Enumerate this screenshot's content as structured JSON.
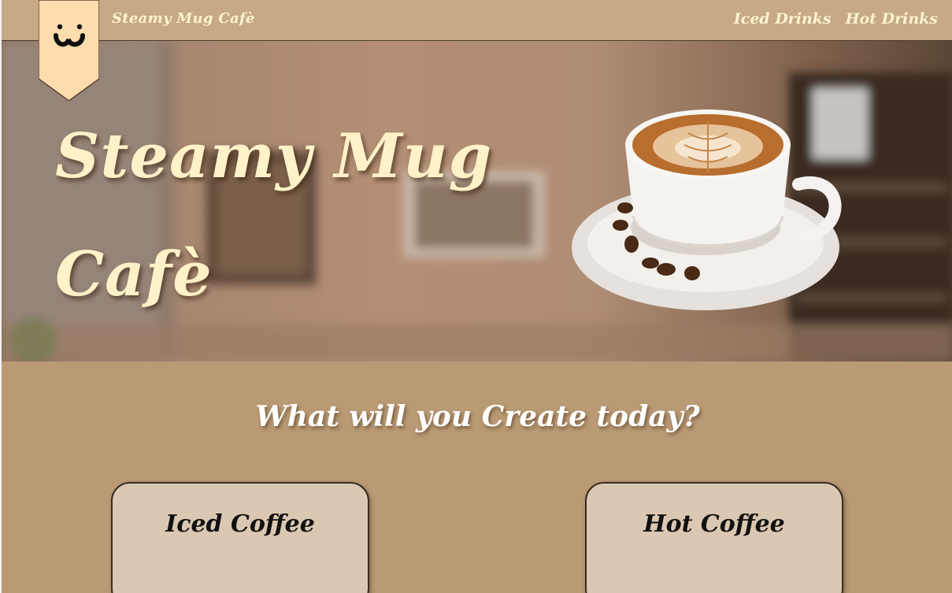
{
  "navbar": {
    "brand": "Steamy Mug Cafè",
    "links": [
      "Iced Drinks",
      "Hot Drinks"
    ]
  },
  "hero": {
    "title_line1": "Steamy Mug",
    "title_line2": "Cafè"
  },
  "main": {
    "prompt": "What will you Create today?",
    "cards": [
      {
        "title": "Iced Coffee"
      },
      {
        "title": "Hot Coffee"
      }
    ]
  },
  "icons": {
    "logo": "smiley-face-icon",
    "hero_image": "latte-cup-icon"
  },
  "colors": {
    "navbar_bg": "#c7a985",
    "page_bg": "#ba9a74",
    "cream_text": "#fff1c8",
    "card_bg": "#dbc8b2",
    "badge": "#ffdcae"
  }
}
